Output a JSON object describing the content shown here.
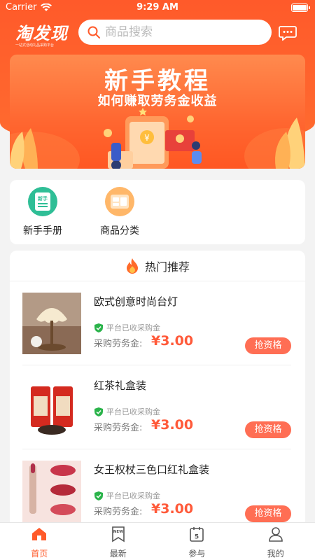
{
  "status_bar": {
    "carrier": "Carrier",
    "time": "9:29 AM"
  },
  "header": {
    "logo_text": "淘发现",
    "logo_sub": "一站式活动礼品采购平台",
    "search_placeholder": "商品搜索",
    "accent_color": "#ff5a2a"
  },
  "banner": {
    "title": "新手教程",
    "subtitle": "如何赚取劳务金收益"
  },
  "quick_links": [
    {
      "label": "新手手册",
      "icon": "handbook-icon",
      "badge": "新手"
    },
    {
      "label": "商品分类",
      "icon": "category-icon"
    }
  ],
  "hot": {
    "title": "热门推荐",
    "verify_text": "平台已收采购金",
    "price_label": "采购劳务金:",
    "button_label": "抢资格",
    "products": [
      {
        "name": "欧式创意时尚台灯",
        "price": "¥3.00",
        "image": "table-lamp"
      },
      {
        "name": "红茶礼盒装",
        "price": "¥3.00",
        "image": "tea-gift-box"
      },
      {
        "name": "女王权杖三色口红礼盒装",
        "price": "¥3.00",
        "image": "lipstick-gift-box"
      }
    ]
  },
  "tabbar": [
    {
      "label": "首页",
      "icon": "home-icon",
      "active": true
    },
    {
      "label": "最新",
      "icon": "new-bookmark-icon",
      "badge": "NEW",
      "active": false
    },
    {
      "label": "参与",
      "icon": "calendar-icon",
      "badge": "5",
      "active": false
    },
    {
      "label": "我的",
      "icon": "user-icon",
      "active": false
    }
  ]
}
